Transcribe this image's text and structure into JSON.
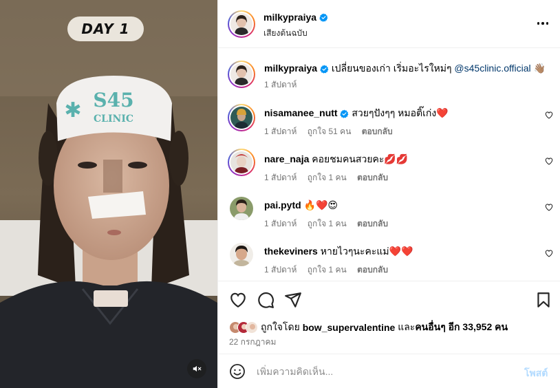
{
  "post": {
    "overlay_label": "DAY 1",
    "headband_text": "S45 CLINIC",
    "author": {
      "username": "milkypraiya",
      "verified": true,
      "audio_label": "เสียงต้นฉบับ"
    },
    "caption": {
      "username": "milkypraiya",
      "text": "เปลี่ยนของเก่า เริ่มอะไรใหม่ๆ",
      "mention": "@s45clinic.official",
      "emoji": "👋🏽",
      "time": "1 สัปดาห์"
    },
    "comments": [
      {
        "username": "nisamanee_nutt",
        "verified": true,
        "text": "สวยๆปังๆๆ หมอติ๊เก่ง❤️",
        "time": "1 สัปดาห์",
        "likes": "ถูกใจ 51 คน",
        "reply": "ตอบกลับ"
      },
      {
        "username": "nare_naja",
        "verified": false,
        "text": "คอยชมคนสวยคะ💋💋",
        "time": "1 สัปดาห์",
        "likes": "ถูกใจ 1 คน",
        "reply": "ตอบกลับ"
      },
      {
        "username": "pai.pytd",
        "verified": false,
        "text": "🔥❤️😍",
        "time": "1 สัปดาห์",
        "likes": "ถูกใจ 1 คน",
        "reply": "ตอบกลับ"
      },
      {
        "username": "thekeviners",
        "verified": false,
        "text": "หายไวๆนะคะแม่❤️❤️",
        "time": "1 สัปดาห์",
        "likes": "ถูกใจ 1 คน",
        "reply": "ตอบกลับ"
      }
    ],
    "likes": {
      "prefix": "ถูกใจโดย",
      "liker": "bow_supervalentine",
      "middle": "และ",
      "others": "คนอื่นๆ อีก 33,952 คน"
    },
    "date": "22 กรกฎาคม",
    "composer": {
      "placeholder": "เพิ่มความคิดเห็น...",
      "post_label": "โพสต์"
    },
    "icons": {
      "like": "heart-icon",
      "comment": "comment-icon",
      "share": "send-icon",
      "save": "bookmark-icon",
      "more": "more-horizontal-icon",
      "mute": "speaker-muted-icon",
      "emoji": "smiley-icon"
    },
    "colors": {
      "verified_blue": "#0095f6",
      "mention_blue": "#00376b",
      "meta_gray": "#737373",
      "post_disabled": "#b3dbff"
    }
  }
}
